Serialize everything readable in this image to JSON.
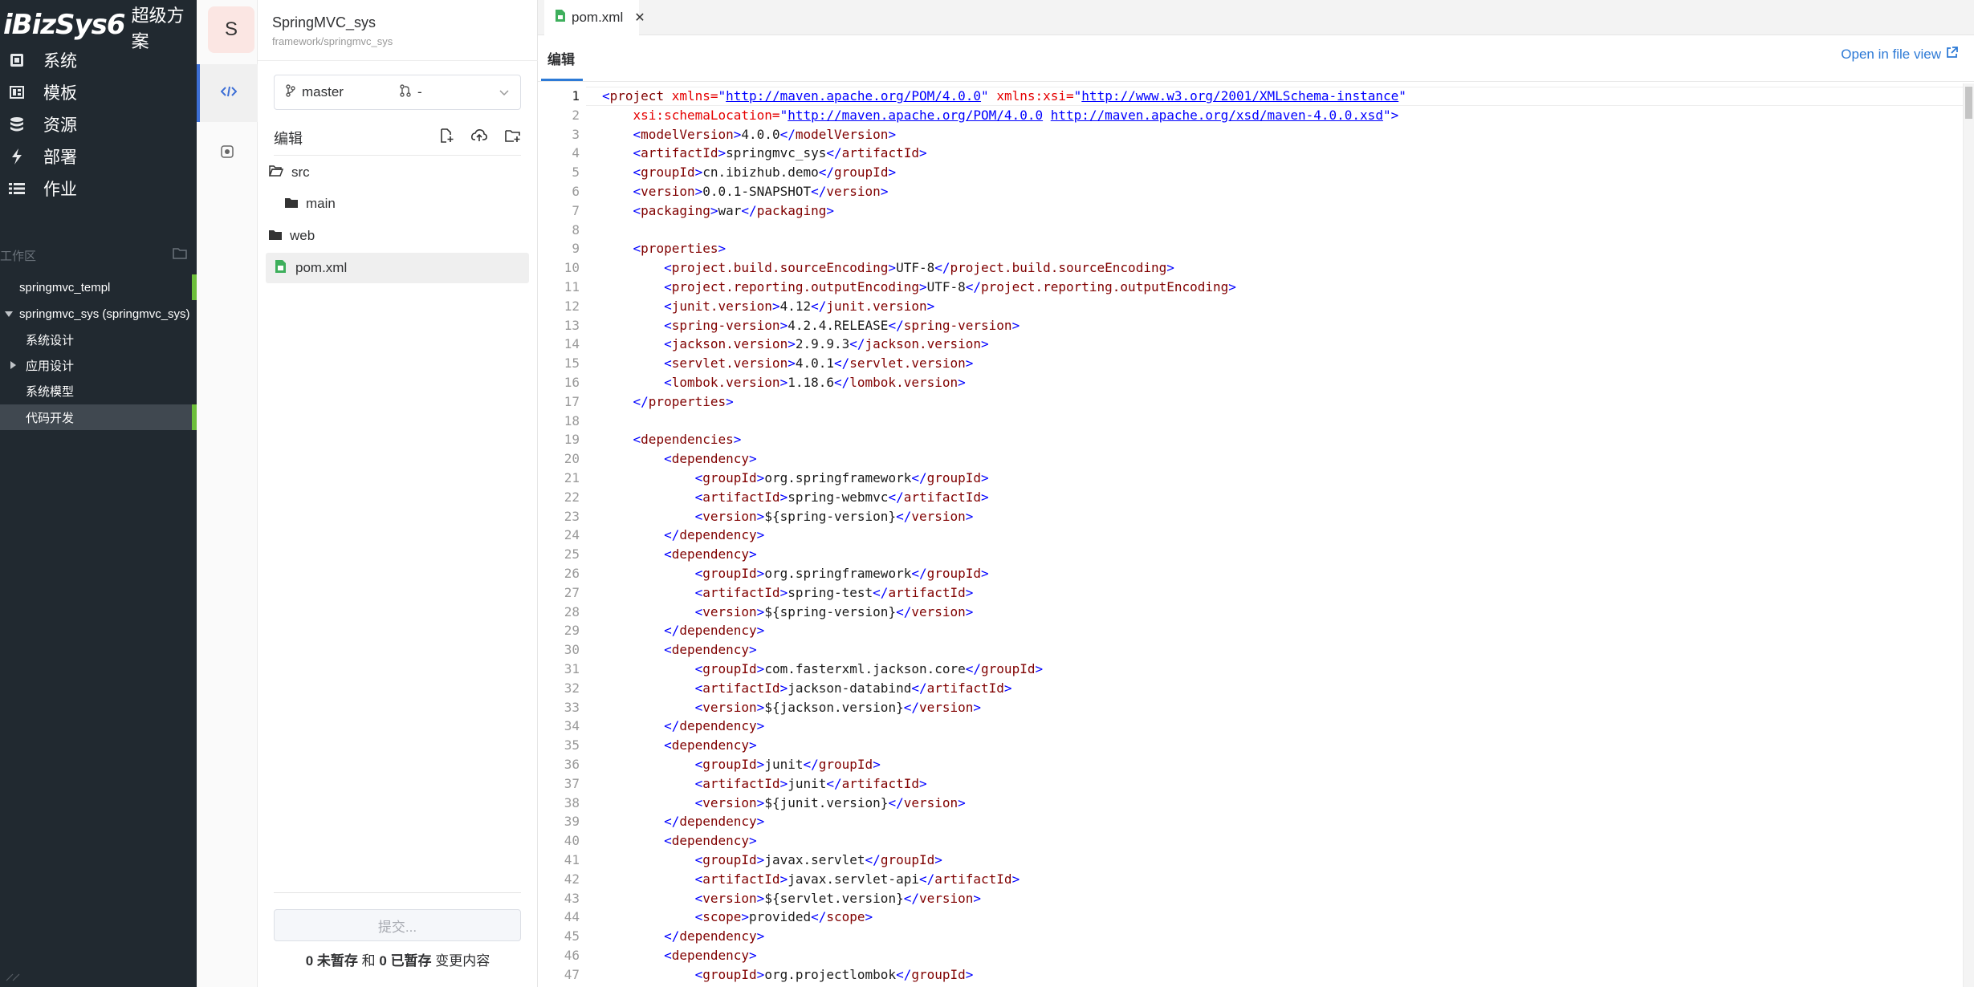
{
  "sidebar": {
    "logo_brand": "iBizSys6",
    "logo_sub": "超级方案",
    "nav": [
      {
        "label": "系统",
        "icon": "system-icon"
      },
      {
        "label": "模板",
        "icon": "template-icon"
      },
      {
        "label": "资源",
        "icon": "database-icon"
      },
      {
        "label": "部署",
        "icon": "bolt-icon"
      },
      {
        "label": "作业",
        "icon": "list-icon"
      }
    ],
    "workspace_label": "工作区",
    "tree": [
      {
        "label": "springmvc_templ",
        "level": 0,
        "arrow": "",
        "active": false
      },
      {
        "label": "springmvc_sys (springmvc_sys)",
        "level": 0,
        "arrow": "down",
        "active": false
      },
      {
        "label": "系统设计",
        "level": 1,
        "arrow": "",
        "active": false
      },
      {
        "label": "应用设计",
        "level": 1,
        "arrow": "right",
        "active": false
      },
      {
        "label": "系统模型",
        "level": 1,
        "arrow": "",
        "active": false
      },
      {
        "label": "代码开发",
        "level": 1,
        "arrow": "",
        "active": true
      }
    ]
  },
  "project": {
    "avatar_letter": "S",
    "name": "SpringMVC_sys",
    "path": "framework/springmvc_sys",
    "branch": "master",
    "merge_request": "-",
    "edit_title": "编辑",
    "files": [
      {
        "name": "src",
        "type": "folder-open",
        "indent": 0
      },
      {
        "name": "main",
        "type": "folder",
        "indent": 1
      },
      {
        "name": "web",
        "type": "folder",
        "indent": 0
      },
      {
        "name": "pom.xml",
        "type": "xml-file",
        "indent": 0,
        "selected": true
      }
    ],
    "commit_placeholder": "提交...",
    "status": {
      "unstaged_count": "0",
      "unstaged_label": "未暂存",
      "and": "和",
      "staged_count": "0",
      "staged_label": "已暂存",
      "suffix": "变更内容"
    }
  },
  "editor": {
    "tab_label": "pom.xml",
    "mode_tab": "编辑",
    "open_in_file_view": "Open in file view",
    "current_line": 1,
    "lines": [
      "<project xmlns=\"http://maven.apache.org/POM/4.0.0\" xmlns:xsi=\"http://www.w3.org/2001/XMLSchema-instance\"",
      "    xsi:schemaLocation=\"http://maven.apache.org/POM/4.0.0 http://maven.apache.org/xsd/maven-4.0.0.xsd\">",
      "    <modelVersion>4.0.0</modelVersion>",
      "    <artifactId>springmvc_sys</artifactId>",
      "    <groupId>cn.ibizhub.demo</groupId>",
      "    <version>0.0.1-SNAPSHOT</version>",
      "    <packaging>war</packaging>",
      "",
      "    <properties>",
      "        <project.build.sourceEncoding>UTF-8</project.build.sourceEncoding>",
      "        <project.reporting.outputEncoding>UTF-8</project.reporting.outputEncoding>",
      "        <junit.version>4.12</junit.version>",
      "        <spring-version>4.2.4.RELEASE</spring-version>",
      "        <jackson.version>2.9.9.3</jackson.version>",
      "        <servlet.version>4.0.1</servlet.version>",
      "        <lombok.version>1.18.6</lombok.version>",
      "    </properties>",
      "",
      "    <dependencies>",
      "        <dependency>",
      "            <groupId>org.springframework</groupId>",
      "            <artifactId>spring-webmvc</artifactId>",
      "            <version>${spring-version}</version>",
      "        </dependency>",
      "        <dependency>",
      "            <groupId>org.springframework</groupId>",
      "            <artifactId>spring-test</artifactId>",
      "            <version>${spring-version}</version>",
      "        </dependency>",
      "        <dependency>",
      "            <groupId>com.fasterxml.jackson.core</groupId>",
      "            <artifactId>jackson-databind</artifactId>",
      "            <version>${jackson.version}</version>",
      "        </dependency>",
      "        <dependency>",
      "            <groupId>junit</groupId>",
      "            <artifactId>junit</artifactId>",
      "            <version>${junit.version}</version>",
      "        </dependency>",
      "        <dependency>",
      "            <groupId>javax.servlet</groupId>",
      "            <artifactId>javax.servlet-api</artifactId>",
      "            <version>${servlet.version}</version>",
      "            <scope>provided</scope>",
      "        </dependency>",
      "        <dependency>",
      "            <groupId>org.projectlombok</groupId>"
    ]
  }
}
